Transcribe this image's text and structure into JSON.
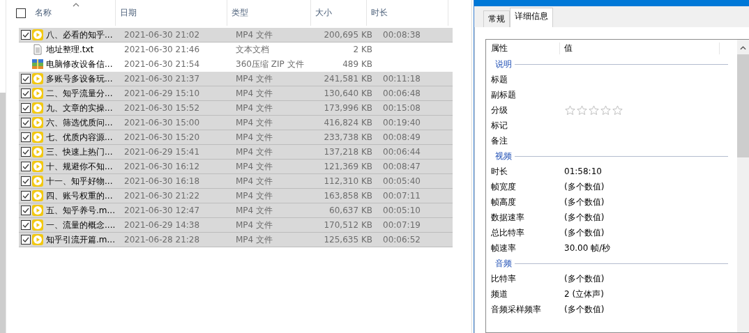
{
  "explorer": {
    "columns": [
      {
        "label": "名称",
        "sorted": true
      },
      {
        "label": "日期",
        "sorted": false
      },
      {
        "label": "类型",
        "sorted": false
      },
      {
        "label": "大小",
        "sorted": false
      },
      {
        "label": "时长",
        "sorted": false
      }
    ],
    "select_all_checked": false,
    "files": [
      {
        "kind": "video",
        "selected": true,
        "name": "八、必看的知乎...",
        "date": "2021-06-30 21:02",
        "type": "MP4 文件",
        "size": "200,695 KB",
        "duration": "00:08:38"
      },
      {
        "kind": "text",
        "selected": false,
        "name": "地址整理.txt",
        "date": "2021-06-30 21:46",
        "type": "文本文档",
        "size": "2 KB"
      },
      {
        "kind": "zip",
        "selected": false,
        "name": "电脑修改设备信...",
        "date": "2021-06-30 21:54",
        "type": "360压缩 ZIP 文件",
        "size": "489 KB"
      },
      {
        "kind": "video",
        "selected": true,
        "name": "多账号多设备玩...",
        "date": "2021-06-30 21:37",
        "type": "MP4 文件",
        "size": "241,581 KB",
        "duration": "00:11:18"
      },
      {
        "kind": "video",
        "selected": true,
        "name": "二、知乎流量分...",
        "date": "2021-06-29 15:10",
        "type": "MP4 文件",
        "size": "130,640 KB",
        "duration": "00:06:48"
      },
      {
        "kind": "video",
        "selected": true,
        "name": "九、文章的实操...",
        "date": "2021-06-30 15:52",
        "type": "MP4 文件",
        "size": "173,996 KB",
        "duration": "00:15:08"
      },
      {
        "kind": "video",
        "selected": true,
        "name": "六、筛选优质问...",
        "date": "2021-06-30 15:00",
        "type": "MP4 文件",
        "size": "416,824 KB",
        "duration": "00:19:40"
      },
      {
        "kind": "video",
        "selected": true,
        "name": "七、优质内容源...",
        "date": "2021-06-30 15:20",
        "type": "MP4 文件",
        "size": "233,738 KB",
        "duration": "00:08:49"
      },
      {
        "kind": "video",
        "selected": true,
        "name": "三、快速上热门...",
        "date": "2021-06-29 15:41",
        "type": "MP4 文件",
        "size": "137,218 KB",
        "duration": "00:06:44"
      },
      {
        "kind": "video",
        "selected": true,
        "name": "十、规避你不知...",
        "date": "2021-06-30 16:12",
        "type": "MP4 文件",
        "size": "121,369 KB",
        "duration": "00:08:47"
      },
      {
        "kind": "video",
        "selected": true,
        "name": "十一、知乎好物...",
        "date": "2021-06-30 16:18",
        "type": "MP4 文件",
        "size": "112,310 KB",
        "duration": "00:05:40"
      },
      {
        "kind": "video",
        "selected": true,
        "name": "四、账号权重的...",
        "date": "2021-06-30 21:22",
        "type": "MP4 文件",
        "size": "163,858 KB",
        "duration": "00:07:11"
      },
      {
        "kind": "video",
        "selected": true,
        "name": "五、知乎养号.m...",
        "date": "2021-06-30 12:47",
        "type": "MP4 文件",
        "size": "60,637 KB",
        "duration": "00:05:10"
      },
      {
        "kind": "video",
        "selected": true,
        "name": "一、流量的概念....",
        "date": "2021-06-29 14:38",
        "type": "MP4 文件",
        "size": "170,512 KB",
        "duration": "00:07:19"
      },
      {
        "kind": "video",
        "selected": true,
        "name": "知乎引流开篇.m...",
        "date": "2021-06-28 21:28",
        "type": "MP4 文件",
        "size": "125,635 KB",
        "duration": "00:06:52"
      }
    ]
  },
  "properties_dialog": {
    "tabs": [
      {
        "label": "常规",
        "selected": false
      },
      {
        "label": "详细信息",
        "selected": true
      }
    ],
    "columns": [
      "属性",
      "值"
    ],
    "sections": [
      {
        "title": "说明",
        "items": [
          {
            "kind": "text",
            "name": "标题"
          },
          {
            "kind": "text",
            "name": "副标题"
          },
          {
            "kind": "rating",
            "name": "分级",
            "stars": 0
          },
          {
            "kind": "text",
            "name": "标记"
          },
          {
            "kind": "text",
            "name": "备注"
          }
        ]
      },
      {
        "title": "视频",
        "items": [
          {
            "kind": "text",
            "name": "时长",
            "value": "01:58:10"
          },
          {
            "kind": "text",
            "name": "帧宽度",
            "value": "(多个数值)"
          },
          {
            "kind": "text",
            "name": "帧高度",
            "value": "(多个数值)"
          },
          {
            "kind": "text",
            "name": "数据速率",
            "value": "(多个数值)"
          },
          {
            "kind": "text",
            "name": "总比特率",
            "value": "(多个数值)"
          },
          {
            "kind": "text",
            "name": "帧速率",
            "value": "30.00 帧/秒"
          }
        ]
      },
      {
        "title": "音频",
        "items": [
          {
            "kind": "text",
            "name": "比特率",
            "value": "(多个数值)"
          },
          {
            "kind": "text",
            "name": "频道",
            "value": "2 (立体声)"
          },
          {
            "kind": "text",
            "name": "音频采样频率",
            "value": "(多个数值)"
          }
        ]
      }
    ]
  }
}
